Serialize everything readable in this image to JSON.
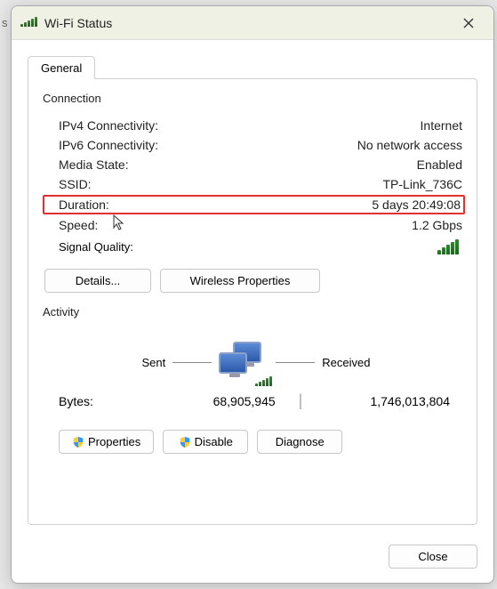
{
  "window": {
    "title": "Wi-Fi Status"
  },
  "tabs": {
    "general": "General"
  },
  "connection": {
    "group_label": "Connection",
    "ipv4_label": "IPv4 Connectivity:",
    "ipv4_value": "Internet",
    "ipv6_label": "IPv6 Connectivity:",
    "ipv6_value": "No network access",
    "media_state_label": "Media State:",
    "media_state_value": "Enabled",
    "ssid_label": "SSID:",
    "ssid_value": "TP-Link_736C",
    "duration_label": "Duration:",
    "duration_value": "5 days 20:49:08",
    "speed_label": "Speed:",
    "speed_value": "1.2 Gbps",
    "signal_quality_label": "Signal Quality:",
    "details_button": "Details...",
    "wireless_props_button": "Wireless Properties"
  },
  "activity": {
    "group_label": "Activity",
    "sent_label": "Sent",
    "received_label": "Received",
    "bytes_label": "Bytes:",
    "bytes_sent": "68,905,945",
    "bytes_received": "1,746,013,804"
  },
  "buttons": {
    "properties": "Properties",
    "disable": "Disable",
    "diagnose": "Diagnose",
    "close": "Close"
  }
}
